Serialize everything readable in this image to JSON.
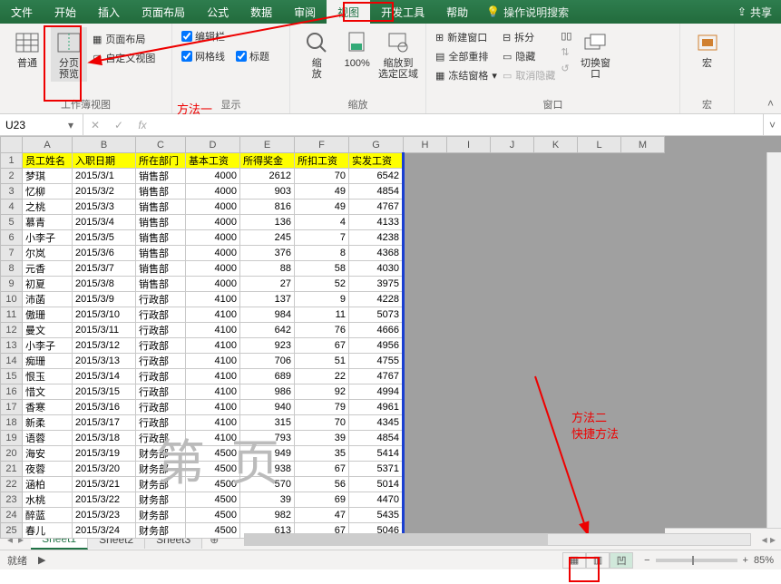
{
  "menu": {
    "tabs": [
      "文件",
      "开始",
      "插入",
      "页面布局",
      "公式",
      "数据",
      "审阅",
      "视图",
      "开发工具",
      "帮助"
    ],
    "active_index": 7,
    "search_hint": "操作说明搜索",
    "share": "共享"
  },
  "ribbon": {
    "g_view": {
      "normal": "普通",
      "pagebreak": "分页\n预览",
      "pagelayout": "页面布局",
      "custom": "自定义视图",
      "label": "工作簿视图"
    },
    "g_show": {
      "formula_bar": "编辑栏",
      "gridlines": "网格线",
      "headings": "标题",
      "label": "显示"
    },
    "g_zoom": {
      "zoom": "缩\n放",
      "hundred": "100%",
      "selection": "缩放到\n选定区域",
      "label": "缩放"
    },
    "g_window": {
      "new_win": "新建窗口",
      "arrange": "全部重排",
      "freeze": "冻结窗格",
      "split": "拆分",
      "hide": "隐藏",
      "unhide": "取消隐藏",
      "switch": "切换窗口",
      "label": "窗口"
    },
    "g_macro": {
      "macro": "宏",
      "label": "宏"
    }
  },
  "annot": {
    "method1": "方法一",
    "method2a": "方法二",
    "method2b": "快捷方法"
  },
  "namebox": "U23",
  "headers": [
    "员工姓名",
    "入职日期",
    "所在部门",
    "基本工资",
    "所得奖金",
    "所扣工资",
    "实发工资"
  ],
  "cols": [
    "A",
    "B",
    "C",
    "D",
    "E",
    "F",
    "G",
    "H",
    "I",
    "J",
    "K",
    "L",
    "M"
  ],
  "chart_data": {
    "type": "table",
    "columns": [
      "员工姓名",
      "入职日期",
      "所在部门",
      "基本工资",
      "所得奖金",
      "所扣工资",
      "实发工资"
    ],
    "rows": [
      [
        "梦琪",
        "2015/3/1",
        "销售部",
        4000,
        2612,
        70,
        6542
      ],
      [
        "忆柳",
        "2015/3/2",
        "销售部",
        4000,
        903,
        49,
        4854
      ],
      [
        "之桃",
        "2015/3/3",
        "销售部",
        4000,
        816,
        49,
        4767
      ],
      [
        "慕青",
        "2015/3/4",
        "销售部",
        4000,
        136,
        4,
        4133
      ],
      [
        "小李子",
        "2015/3/5",
        "销售部",
        4000,
        245,
        7,
        4238
      ],
      [
        "尔岚",
        "2015/3/6",
        "销售部",
        4000,
        376,
        8,
        4368
      ],
      [
        "元香",
        "2015/3/7",
        "销售部",
        4000,
        88,
        58,
        4030
      ],
      [
        "初夏",
        "2015/3/8",
        "销售部",
        4000,
        27,
        52,
        3975
      ],
      [
        "沛菡",
        "2015/3/9",
        "行政部",
        4100,
        137,
        9,
        4228
      ],
      [
        "傲珊",
        "2015/3/10",
        "行政部",
        4100,
        984,
        11,
        5073
      ],
      [
        "曼文",
        "2015/3/11",
        "行政部",
        4100,
        642,
        76,
        4666
      ],
      [
        "小李子",
        "2015/3/12",
        "行政部",
        4100,
        923,
        67,
        4956
      ],
      [
        "痴珊",
        "2015/3/13",
        "行政部",
        4100,
        706,
        51,
        4755
      ],
      [
        "恨玉",
        "2015/3/14",
        "行政部",
        4100,
        689,
        22,
        4767
      ],
      [
        "惜文",
        "2015/3/15",
        "行政部",
        4100,
        986,
        92,
        4994
      ],
      [
        "香寒",
        "2015/3/16",
        "行政部",
        4100,
        940,
        79,
        4961
      ],
      [
        "新柔",
        "2015/3/17",
        "行政部",
        4100,
        315,
        70,
        4345
      ],
      [
        "语蓉",
        "2015/3/18",
        "行政部",
        4100,
        793,
        39,
        4854
      ],
      [
        "海安",
        "2015/3/19",
        "财务部",
        4500,
        949,
        35,
        5414
      ],
      [
        "夜蓉",
        "2015/3/20",
        "财务部",
        4500,
        938,
        67,
        5371
      ],
      [
        "涵柏",
        "2015/3/21",
        "财务部",
        4500,
        570,
        56,
        5014
      ],
      [
        "水桃",
        "2015/3/22",
        "财务部",
        4500,
        39,
        69,
        4470
      ],
      [
        "醉蓝",
        "2015/3/23",
        "财务部",
        4500,
        982,
        47,
        5435
      ],
      [
        "春儿",
        "2015/3/24",
        "财务部",
        4500,
        613,
        67,
        5046
      ]
    ]
  },
  "watermark": "第页",
  "sheets": {
    "items": [
      "Sheet1",
      "Sheet2",
      "Sheet3"
    ],
    "active": 0
  },
  "status": {
    "ready": "就绪",
    "zoom": "85%"
  }
}
